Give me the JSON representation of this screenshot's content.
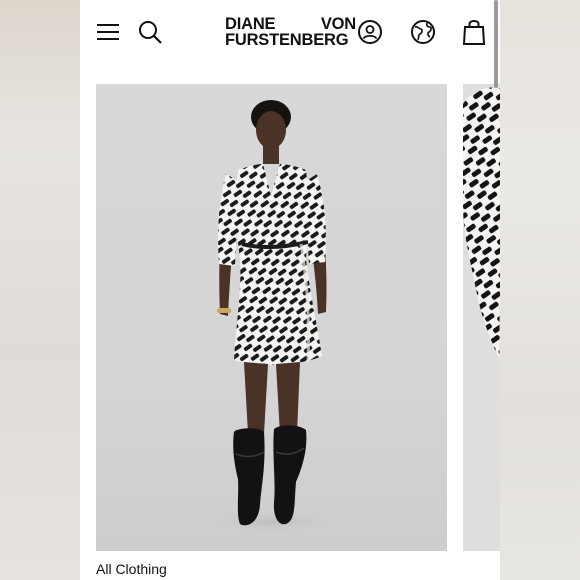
{
  "header": {
    "brand_line1_word1": "DIANE",
    "brand_line1_word2": "VON",
    "brand_line2": "FURSTENBERG",
    "icons": [
      "menu-icon",
      "search-icon",
      "account-icon",
      "globe-icon",
      "shopping-bag-icon"
    ]
  },
  "product": {
    "image": "model-in-wrap-dress-photo",
    "caption": "All Clothing"
  },
  "colors": {
    "background": "#ffffff",
    "photo_backdrop": "#d7d7d8",
    "text": "#111111"
  }
}
